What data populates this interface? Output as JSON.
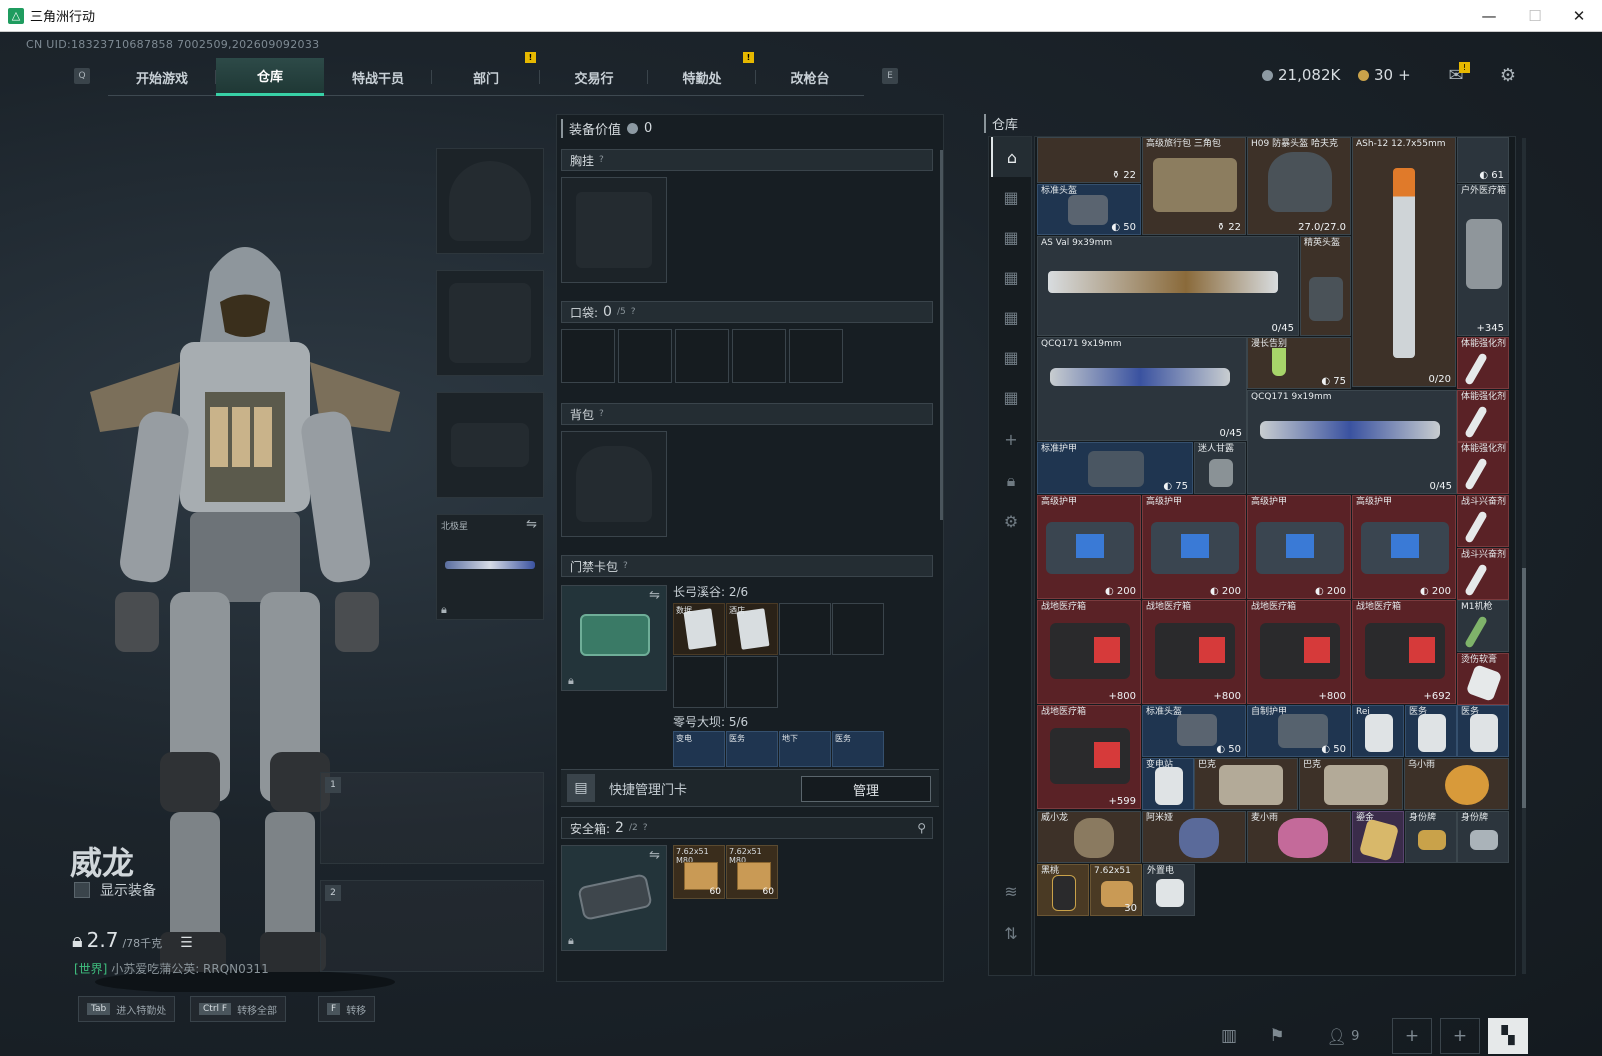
{
  "window": {
    "title": "三角洲行动"
  },
  "header": {
    "uid": "CN UID:18323710687858 7002509,202609092033",
    "nav_left_key": "Q",
    "nav_right_key": "E",
    "tabs": [
      "开始游戏",
      "仓库",
      "特战干员",
      "部门",
      "交易行",
      "特勤处",
      "改枪台"
    ],
    "active_tab": "仓库",
    "currency_silver": "21,082K",
    "currency_gold": "30",
    "plus": "+"
  },
  "operator": {
    "name": "威龙",
    "show_gear_label": "显示装备",
    "weight_value": "2.7",
    "weight_max": "/78千克",
    "world_tag": "[世界]",
    "world_msg": "小苏爱吃蒲公英: RRQN0311",
    "sidearm_label": "北极星",
    "weapon_slot_1": "1",
    "weapon_slot_2": "2"
  },
  "hints": [
    {
      "key": "Tab",
      "label": "进入特勤处"
    },
    {
      "key": "Ctrl F",
      "label": "转移全部"
    },
    {
      "key": "F",
      "label": "转移"
    }
  ],
  "equipment": {
    "value_label": "装备价值",
    "value": "0",
    "chest_label": "胸挂",
    "pocket_label": "口袋:",
    "pocket_count": "0",
    "pocket_max": "/5",
    "backpack_label": "背包",
    "keycard_label": "门禁卡包",
    "map1_title": "长弓溪谷: 2/6",
    "map1_keys": [
      "数据",
      "酒店"
    ],
    "map2_title": "零号大坝: 5/6",
    "map2_keys": [
      "变电",
      "医务",
      "地下",
      "医务"
    ],
    "quick_manage_label": "快捷管理门卡",
    "manage_button": "管理",
    "safebox_label": "安全箱:",
    "safebox_count": "2",
    "safebox_max": "/2",
    "safebox_items": [
      {
        "name": "7.62x51 M80",
        "count": "60"
      },
      {
        "name": "7.62x51 M80",
        "count": "60"
      }
    ]
  },
  "stash": {
    "title": "仓库",
    "items": {
      "r0a": {
        "name": "",
        "value": "22"
      },
      "r0b": {
        "name": "高级旅行包 三角包",
        "value": "22"
      },
      "r0c": {
        "name": "H09 防暴头盔 哈夫克",
        "value": "27.0/27.0"
      },
      "r0d": {
        "name": "ASh-12 12.7x55mm",
        "value": ""
      },
      "r0e": {
        "name": "",
        "value": "61"
      },
      "std_helmet": {
        "name": "标准头盔",
        "value": "50"
      },
      "outdoor_med": {
        "name": "户外医疗箱",
        "value": "345"
      },
      "as_val": {
        "name": "AS Val 9x39mm",
        "value": "0/45"
      },
      "elite_helmet": {
        "name": "精英头盔",
        "value": ""
      },
      "ash12_big": {
        "name": "",
        "value": "0/20"
      },
      "qcq1": {
        "name": "QCQ171 9x19mm",
        "value": "0/45"
      },
      "cocktail": {
        "name": "漫长告别",
        "value": "75"
      },
      "stim1": {
        "name": "体能强化剂",
        "value": ""
      },
      "qcq2": {
        "name": "QCQ171 9x19mm",
        "value": "0/45"
      },
      "stim2": {
        "name": "体能强化剂",
        "value": ""
      },
      "std_armor": {
        "name": "标准护甲",
        "value": "75"
      },
      "sweet": {
        "name": "迷人甘露",
        "value": ""
      },
      "stim3": {
        "name": "体能强化剂",
        "value": ""
      },
      "adv_armor_label": "高级护甲",
      "adv_armor_value": "200",
      "combat_stim": {
        "name": "战斗兴奋剂",
        "value": ""
      },
      "combat_stim2": {
        "name": "战斗兴奋剂",
        "value": ""
      },
      "field_med_label": "战地医疗箱",
      "field_med_values": [
        "800",
        "800",
        "800",
        "692"
      ],
      "m1": {
        "name": "M1机枪",
        "value": ""
      },
      "ointment": {
        "name": "烫伤软膏",
        "value": ""
      },
      "field_med_5": {
        "name": "战地医疗箱",
        "value": "599"
      },
      "std_helmet2": {
        "name": "标准头盔",
        "value": "50"
      },
      "selfmade_armor": {
        "name": "自制护甲",
        "value": "50"
      },
      "rei": {
        "name": "Rei",
        "value": ""
      },
      "med1": {
        "name": "医务",
        "value": ""
      },
      "med2": {
        "name": "医务",
        "value": ""
      },
      "substation": {
        "name": "变电站",
        "value": ""
      },
      "bak1": {
        "name": "巴克",
        "value": ""
      },
      "bak2": {
        "name": "巴克",
        "value": ""
      },
      "wuxiaoyu": {
        "name": "乌小雨",
        "value": ""
      },
      "weixiaolong": {
        "name": "威小龙",
        "value": ""
      },
      "amiya": {
        "name": "阿米娅",
        "value": ""
      },
      "maixiaoyu": {
        "name": "麦小雨",
        "value": ""
      },
      "gold_card": {
        "name": "鎏金",
        "value": ""
      },
      "idtag1": {
        "name": "身份牌",
        "value": ""
      },
      "idtag2": {
        "name": "身份牌",
        "value": ""
      },
      "blackcard": {
        "name": "黑桃",
        "value": ""
      },
      "ammo": {
        "name": "7.62x51",
        "value": "30"
      },
      "device": {
        "name": "外置电",
        "value": ""
      }
    }
  },
  "bottom": {
    "players": "9"
  },
  "colors": {
    "accent": "#38d0a6",
    "badge": "#e6b800"
  }
}
